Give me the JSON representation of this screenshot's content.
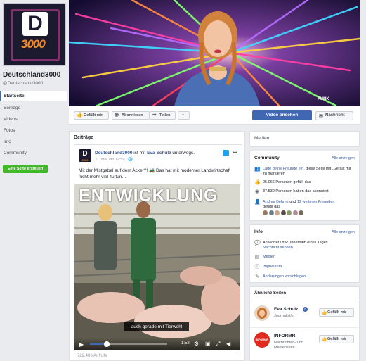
{
  "page": {
    "logo_letter": "D",
    "logo_number": "3000",
    "name": "Deutschland3000",
    "handle": "@Deutschland3000"
  },
  "nav": [
    "Startseite",
    "Beiträge",
    "Videos",
    "Fotos",
    "Info",
    "Community"
  ],
  "create_page_label": "Eine Seite erstellen",
  "cover": {
    "badge": "FUNK",
    "ring_text": "3000"
  },
  "actions": {
    "like": "Gefällt mir",
    "follow": "Abonnieren",
    "share": "Teilen",
    "more": "···",
    "video": "Video ansehen",
    "message": "Nachricht"
  },
  "posts": {
    "heading": "Beiträge",
    "author": "Deutschland3000",
    "with_text": "ist mit",
    "with_person": "Eva Schulz",
    "suffix": "unterwegs.",
    "date": "21. Mai um 12:59 · 🌐",
    "text": "Mit der Mistgabel auf dem Acker?! 🚜 Das hat mit moderner Landwirtschaft nicht mehr viel zu tun…",
    "video_headline": "ENTWICKLUNG",
    "video_subtitle": "auch gerade mit Tierwohl",
    "video_time": "-1:52",
    "video_progress": 0.22,
    "views": "722.406 Aufrufe"
  },
  "medien_heading": "Medien",
  "community": {
    "heading": "Community",
    "link": "Alle anzeigen",
    "invite_link": "Lade deine Freunde ein,",
    "invite_rest": "diese Seite mit „Gefällt mir“ zu markieren",
    "likes": "25.066 Personen gefällt das",
    "follows": "37.530 Personen haben das abonniert",
    "friends_a": "Andrea Behme",
    "friends_mid": "und",
    "friends_b": "12 weiteren Freunden",
    "friends_rest": "gefällt das"
  },
  "info": {
    "heading": "Info",
    "link": "Alle anzeigen",
    "response": "Antwortet i.d.R. innerhalb eines Tages",
    "send_msg": "Nachricht senden",
    "medien": "Medien",
    "impressum": "Impressum",
    "suggest": "Änderungen vorschlagen"
  },
  "similar": {
    "heading": "Ähnliche Seiten",
    "items": [
      {
        "name": "Eva Schulz",
        "category": "Journalist/in",
        "button": "Gefällt mir"
      },
      {
        "name": "INFORMR",
        "category": "Nachrichten- und Medienseite",
        "button": "Gefällt mir",
        "logo_text": "INFORMR"
      }
    ]
  },
  "colors": {
    "brand": "#4267b2",
    "link": "#385898",
    "green": "#42b72a",
    "bg": "#e9ebee"
  }
}
